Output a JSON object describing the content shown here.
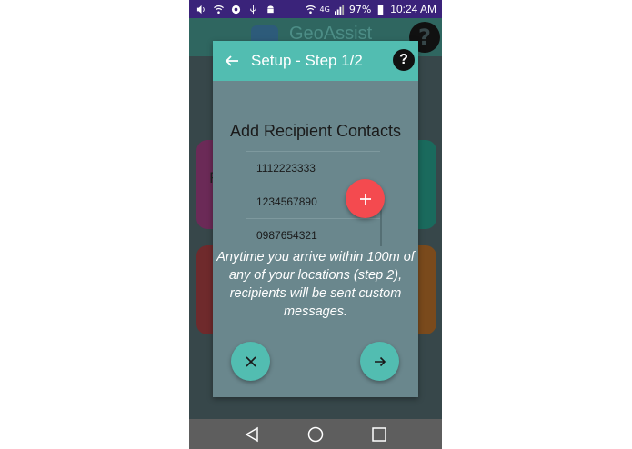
{
  "status_bar": {
    "network_label": "4G",
    "battery_percent": "97%",
    "time": "10:24 AM",
    "icons": [
      "volume-icon",
      "wifi-icon",
      "chrome-icon",
      "usb-icon",
      "android-icon",
      "wifi-calling-icon",
      "signal-icon",
      "battery-icon"
    ]
  },
  "app": {
    "title": "GeoAssist",
    "help_label": "?",
    "tile_letter": "P"
  },
  "dialog": {
    "title": "Setup - Step 1/2",
    "help_label": "?",
    "section_title": "Add Recipient Contacts",
    "contacts": [
      "1112223333",
      "1234567890",
      "0987654321"
    ],
    "info_text": "Anytime you arrive within 100m of any of your locations (step 2), recipients will be sent custom messages."
  },
  "colors": {
    "header": "#52bdb1",
    "add_fab": "#f44a4f",
    "dialog_body": "#6a878d",
    "status_bar": "#3a237a",
    "nav_bar": "#5e5e5e"
  }
}
